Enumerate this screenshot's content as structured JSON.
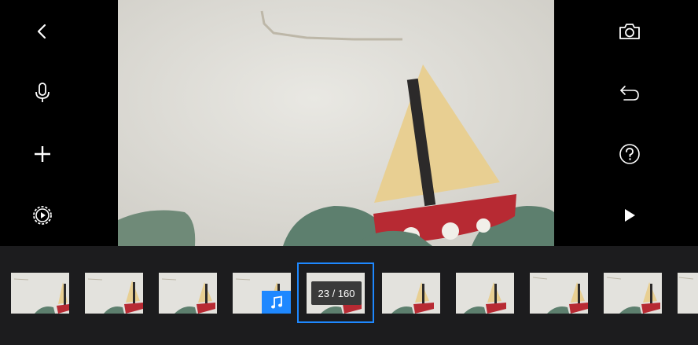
{
  "toolbar_left": {
    "back_icon": "chevron-left-icon",
    "mic_icon": "microphone-icon",
    "add_icon": "plus-icon",
    "settings_icon": "gear-icon"
  },
  "toolbar_right": {
    "camera_icon": "camera-icon",
    "undo_icon": "undo-icon",
    "help_icon": "question-circle-icon",
    "play_icon": "play-icon"
  },
  "timeline": {
    "frame_counter": "23 / 160",
    "music_icon": "music-note-icon",
    "accent_color": "#1e88ff"
  }
}
